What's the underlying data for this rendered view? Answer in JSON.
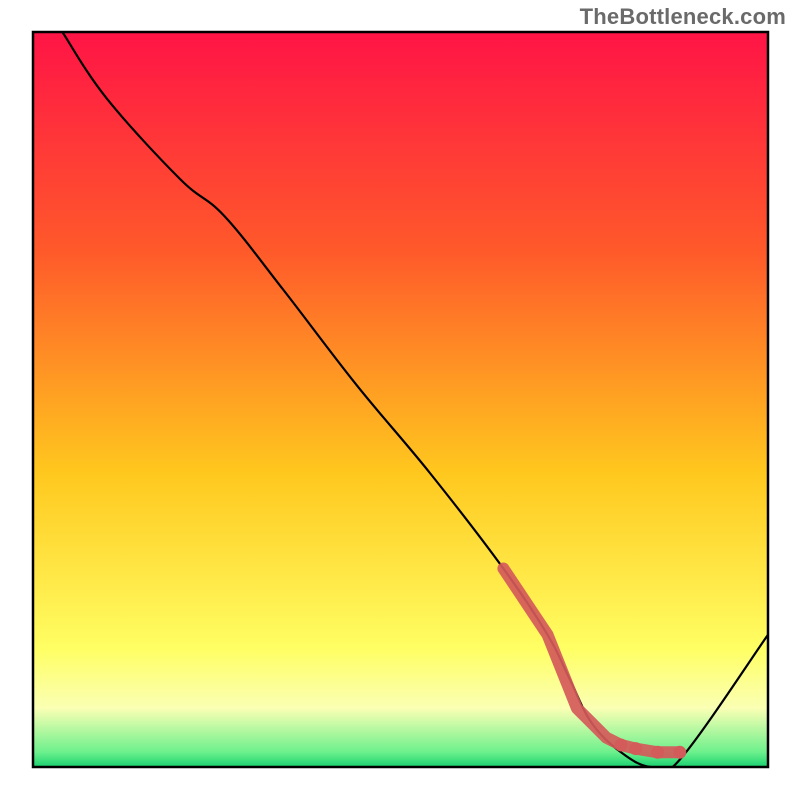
{
  "watermark": "TheBottleneck.com",
  "chart_data": {
    "type": "line",
    "title": "",
    "xlabel": "",
    "ylabel": "",
    "xlim": [
      0,
      100
    ],
    "ylim": [
      0,
      100
    ],
    "grid": false,
    "legend": false,
    "x": [
      4,
      10,
      20,
      26,
      34,
      44,
      54,
      64,
      70,
      73,
      76,
      80,
      84,
      88,
      100
    ],
    "values": [
      100,
      91,
      80,
      75,
      65,
      52,
      40,
      27,
      18,
      12,
      6,
      2,
      0,
      1,
      18
    ],
    "series_name": "curve",
    "gradient_bands": [
      {
        "y0": 100,
        "y1": 70,
        "c0": "#ff1446",
        "c1": "#ff5a2a"
      },
      {
        "y0": 70,
        "y1": 40,
        "c0": "#ff5a2a",
        "c1": "#ffc81e"
      },
      {
        "y0": 40,
        "y1": 16,
        "c0": "#ffc81e",
        "c1": "#ffff64"
      },
      {
        "y0": 16,
        "y1": 8,
        "c0": "#ffff64",
        "c1": "#faffb4"
      },
      {
        "y0": 8,
        "y1": 2,
        "c0": "#faffb4",
        "c1": "#6bf08c"
      },
      {
        "y0": 2,
        "y1": 0,
        "c0": "#6bf08c",
        "c1": "#18d070"
      }
    ],
    "markers": {
      "color": "#d45a5a",
      "points": [
        {
          "x": 64,
          "y": 27
        },
        {
          "x": 66,
          "y": 24
        },
        {
          "x": 68,
          "y": 21
        },
        {
          "x": 70,
          "y": 18
        },
        {
          "x": 72,
          "y": 13
        },
        {
          "x": 74,
          "y": 8
        },
        {
          "x": 76,
          "y": 6
        },
        {
          "x": 78,
          "y": 4
        },
        {
          "x": 80,
          "y": 3
        },
        {
          "x": 82,
          "y": 2.5
        },
        {
          "x": 85,
          "y": 2
        },
        {
          "x": 88,
          "y": 2
        }
      ]
    }
  }
}
